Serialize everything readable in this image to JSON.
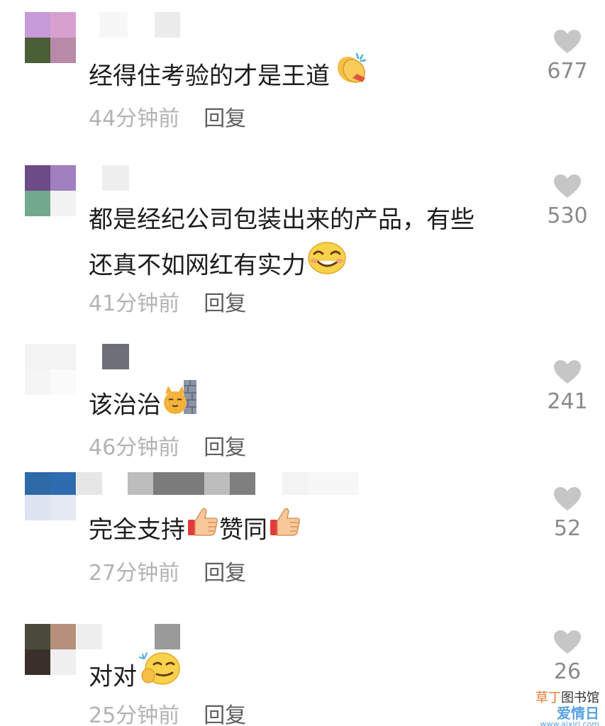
{
  "comments": [
    {
      "text_lines": [
        "经得住考验的才是王道"
      ],
      "emoji": "clapping-hands-icon",
      "time": "44分钟前",
      "reply": "回复",
      "likes": "677",
      "avatar_colors": [
        "#c79ad9",
        "#d8a0cf",
        "#4a5e38",
        "#b88aa8"
      ]
    },
    {
      "text_lines": [
        "都是经纪公司包装出来的产品，有些",
        "还真不如网红有实力"
      ],
      "emoji": "smirking-face-icon",
      "time": "41分钟前",
      "reply": "回复",
      "likes": "530",
      "avatar_colors": [
        "#6c4b86",
        "#a07fbf",
        "#72a88e",
        "#f2f2f2"
      ]
    },
    {
      "text_lines": [
        "该治治"
      ],
      "emoji": "cat-peeking-wall-icon",
      "time": "46分钟前",
      "reply": "回复",
      "likes": "241",
      "avatar_colors": [
        "#f3f3f3",
        "#f3f3f3",
        "#f5f5f5",
        "#fafafa"
      ]
    },
    {
      "text_lines": [
        "完全支持",
        "赞同"
      ],
      "emoji": "thumbs-up-icon",
      "time": "27分钟前",
      "reply": "回复",
      "likes": "52",
      "avatar_colors": [
        "#2f6aa8",
        "#2e6cb0",
        "#dde3f0",
        "#e4e9f3"
      ]
    },
    {
      "text_lines": [
        "对对"
      ],
      "emoji": "thinking-smug-face-icon",
      "time": "25分钟前",
      "reply": "回复",
      "likes": "26",
      "avatar_colors": [
        "#4a4a3c",
        "#b6907a",
        "#3a2f2a",
        "#f0f0f0"
      ]
    }
  ],
  "watermark": {
    "line1_a": "草丁",
    "line1_b": "图书馆",
    "line2": "爱情日",
    "url": "www.aixiri.com"
  },
  "colors": {
    "text": "#1d1d1d",
    "time": "#b3b3b3",
    "reply": "#5f5f5f",
    "heart": "#c6c6c6",
    "count": "#8a8a8a"
  }
}
